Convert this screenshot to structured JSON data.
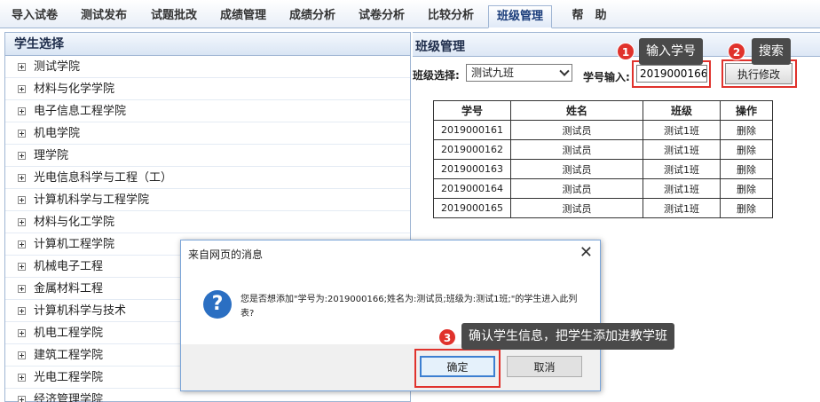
{
  "nav": {
    "tabs": [
      {
        "label": "导入试卷"
      },
      {
        "label": "测试发布"
      },
      {
        "label": "试题批改"
      },
      {
        "label": "成绩管理"
      },
      {
        "label": "成绩分析"
      },
      {
        "label": "试卷分析"
      },
      {
        "label": "比较分析"
      },
      {
        "label": "班级管理"
      },
      {
        "label": "帮　助"
      }
    ],
    "active": "班级管理"
  },
  "left_panel": {
    "title": "学生选择",
    "items": [
      {
        "label": "测试学院"
      },
      {
        "label": "材料与化学学院"
      },
      {
        "label": "电子信息工程学院"
      },
      {
        "label": "机电学院"
      },
      {
        "label": "理学院"
      },
      {
        "label": "光电信息科学与工程（工）"
      },
      {
        "label": "计算机科学与工程学院"
      },
      {
        "label": "材料与化工学院"
      },
      {
        "label": "计算机工程学院"
      },
      {
        "label": "机械电子工程"
      },
      {
        "label": "金属材料工程"
      },
      {
        "label": "计算机科学与技术"
      },
      {
        "label": "机电工程学院"
      },
      {
        "label": "建筑工程学院"
      },
      {
        "label": "光电工程学院"
      },
      {
        "label": "经济管理学院"
      }
    ]
  },
  "right_panel": {
    "title": "班级管理",
    "class_select_label": "班级选择:",
    "class_select_value": "测试九班",
    "student_id_label": "学号输入:",
    "student_id_value": "2019000166",
    "execute_button": "执行修改",
    "table": {
      "headers": [
        "学号",
        "姓名",
        "班级",
        "操作"
      ],
      "rows": [
        [
          "2019000161",
          "测试员",
          "测试1班",
          "删除"
        ],
        [
          "2019000162",
          "测试员",
          "测试1班",
          "删除"
        ],
        [
          "2019000163",
          "测试员",
          "测试1班",
          "删除"
        ],
        [
          "2019000164",
          "测试员",
          "测试1班",
          "删除"
        ],
        [
          "2019000165",
          "测试员",
          "测试1班",
          "删除"
        ]
      ]
    }
  },
  "callouts": [
    {
      "number": "1",
      "text": "输入学号"
    },
    {
      "number": "2",
      "text": "搜索"
    },
    {
      "number": "3",
      "text": "确认学生信息，把学生添加进教学班"
    }
  ],
  "dialog": {
    "title": "来自网页的消息",
    "close_glyph": "✕",
    "icon_glyph": "?",
    "message": "您是否想添加\"学号为:2019000166;姓名为:测试员;班级为:测试1班;\"的学生进入此列表?",
    "ok_label": "确定",
    "cancel_label": "取消"
  },
  "colors": {
    "highlight": "#e0322c",
    "callout_bg": "#4a4a4a",
    "dialog_border": "#7aa4d8",
    "question_icon": "#2b6fc2"
  }
}
